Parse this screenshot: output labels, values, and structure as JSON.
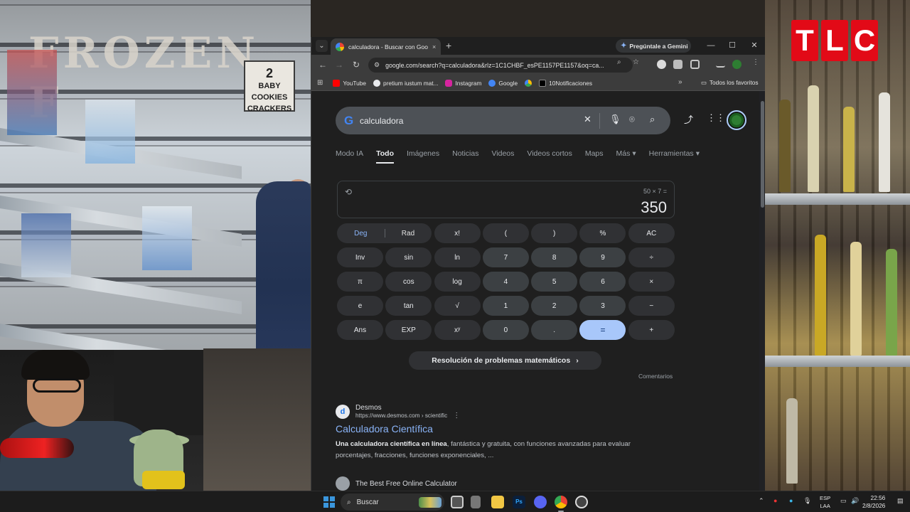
{
  "overlay": {
    "tlc_letters": [
      "T",
      "L",
      "C"
    ],
    "frozen_sign": "FROZEN F",
    "aisle_sign": {
      "number": "2",
      "lines": [
        "BABY",
        "COOKIES",
        "CRACKERS"
      ]
    }
  },
  "browser": {
    "tab_title": "calculadora - Buscar con Google",
    "tab_close": "×",
    "new_tab": "+",
    "gemini_label": "Pregúntale a Gemini",
    "window_controls": {
      "minimize": "—",
      "maximize": "☐",
      "close": "✕"
    },
    "url": "google.com/search?q=calculadora&rlz=1C1CHBF_esPE1157PE1157&oq=ca...",
    "bookmarks": [
      {
        "label": "YouTube",
        "color": "#ff0000"
      },
      {
        "label": "pretium iustum mat...",
        "color": "#e8eaed"
      },
      {
        "label": "Instagram",
        "color": "#d6249f"
      },
      {
        "label": "Google",
        "color": "#4285f4"
      },
      {
        "label": "",
        "color": "#34a853"
      },
      {
        "label": "10Notificaciones",
        "color": "#000000"
      }
    ],
    "bookmarks_all": "Todos los favoritos"
  },
  "search": {
    "query": "calculadora",
    "tabs": [
      "Modo IA",
      "Todo",
      "Imágenes",
      "Noticias",
      "Videos",
      "Videos cortos",
      "Maps",
      "Más",
      "Herramientas"
    ],
    "active_tab": "Todo"
  },
  "calculator": {
    "expression": "50 × 7 =",
    "result": "350",
    "mode": {
      "deg": "Deg",
      "rad": "Rad"
    },
    "keys": [
      [
        "x!",
        "(",
        ")",
        "%",
        "AC"
      ],
      [
        "Inv",
        "sin",
        "ln",
        "7",
        "8",
        "9",
        "÷"
      ],
      [
        "π",
        "cos",
        "log",
        "4",
        "5",
        "6",
        "×"
      ],
      [
        "e",
        "tan",
        "√",
        "1",
        "2",
        "3",
        "−"
      ],
      [
        "Ans",
        "EXP",
        "xʸ",
        "0",
        ".",
        "=",
        "+"
      ]
    ],
    "math_button": "Resolución de problemas matemáticos",
    "feedback": "Comentarios"
  },
  "results": [
    {
      "site": "Desmos",
      "url": "https://www.desmos.com › scientific",
      "title": "Calculadora Científica",
      "snippet_bold": "Una calculadora científica en línea",
      "snippet_rest": ", fantástica y gratuita, con funciones avanzadas para evaluar porcentajes, fracciones, funciones exponenciales, ..."
    },
    {
      "site": "The Best Free Online Calculator"
    }
  ],
  "taskbar": {
    "search_placeholder": "Buscar",
    "language": "ESP",
    "region": "LAA",
    "time": "22:56",
    "date": "2/8/2026"
  }
}
